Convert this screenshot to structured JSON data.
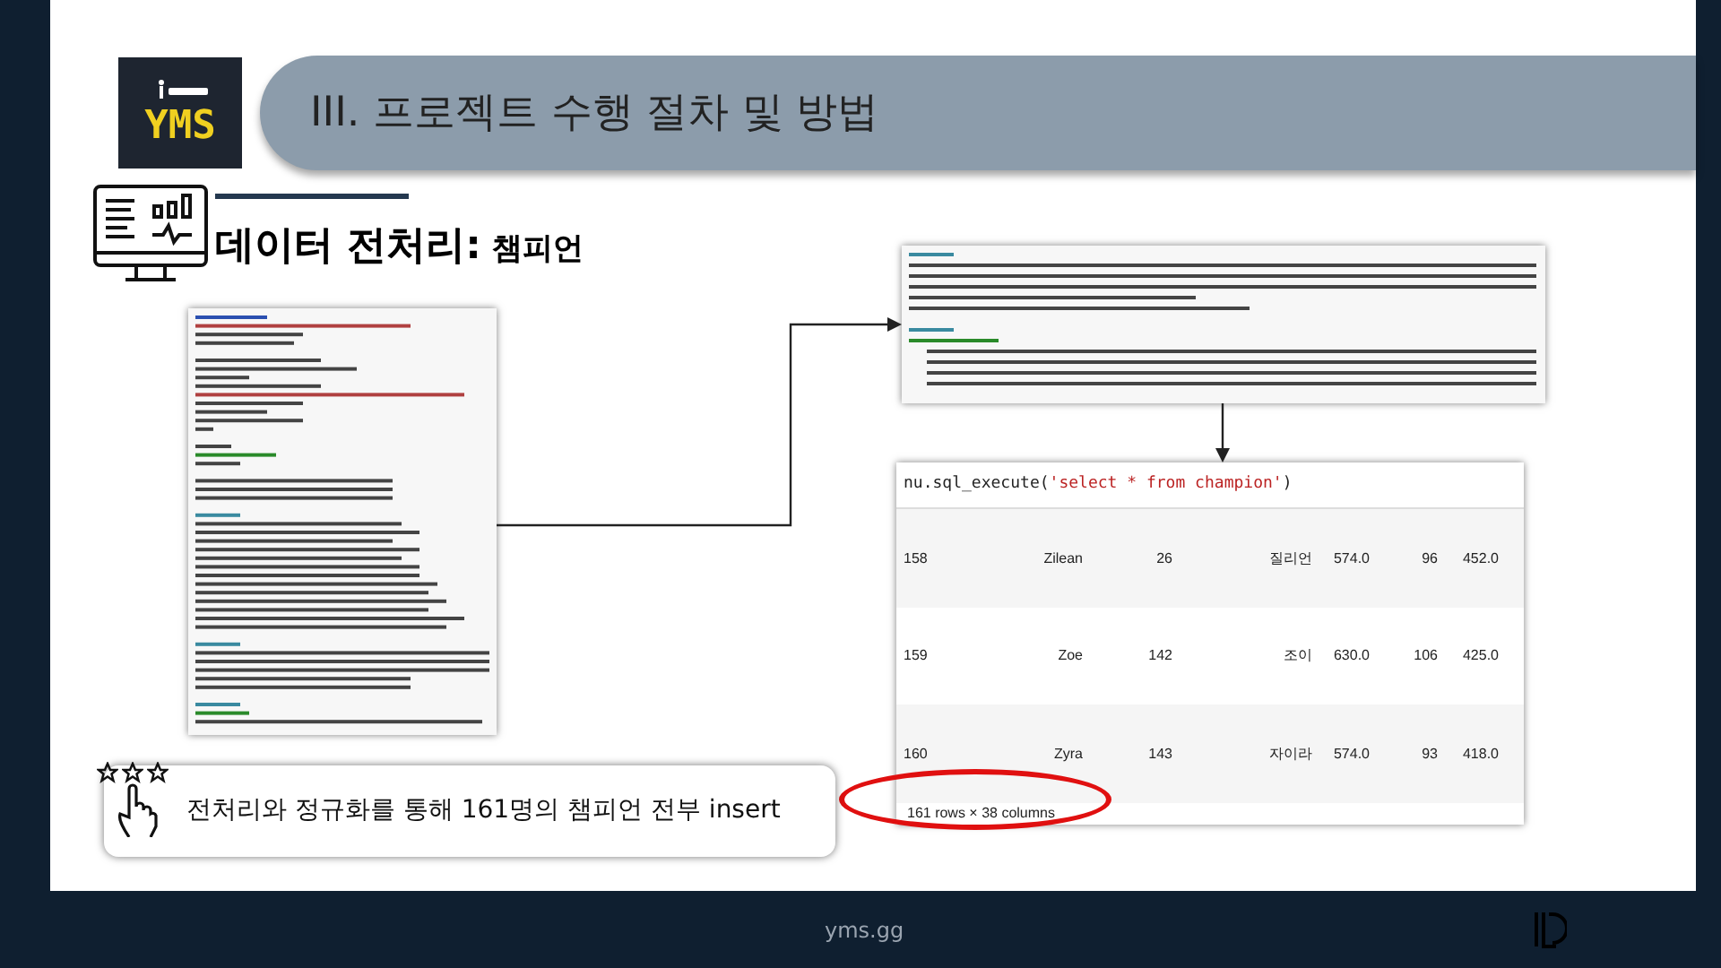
{
  "logo": {
    "text": "YMS"
  },
  "header": {
    "title": "III. 프로젝트 수행 절차 및 방법"
  },
  "section": {
    "title": "데이터 전처리:",
    "subtitle": "챔피언"
  },
  "output": {
    "code_prefix": "nu.sql_execute(",
    "code_string": "'select * from champion'",
    "code_suffix": ")",
    "rows": [
      [
        "158",
        "Zilean",
        "26",
        "질리언",
        "574.0",
        "96",
        "452.0"
      ],
      [
        "159",
        "Zoe",
        "142",
        "조이",
        "630.0",
        "106",
        "425.0"
      ],
      [
        "160",
        "Zyra",
        "143",
        "자이라",
        "574.0",
        "93",
        "418.0"
      ]
    ],
    "footer": "161 rows × 38 columns"
  },
  "callout": {
    "text": "전처리와 정규화를 통해 161명의 챔피언 전부 insert"
  },
  "footer": {
    "site": "yms.gg"
  }
}
